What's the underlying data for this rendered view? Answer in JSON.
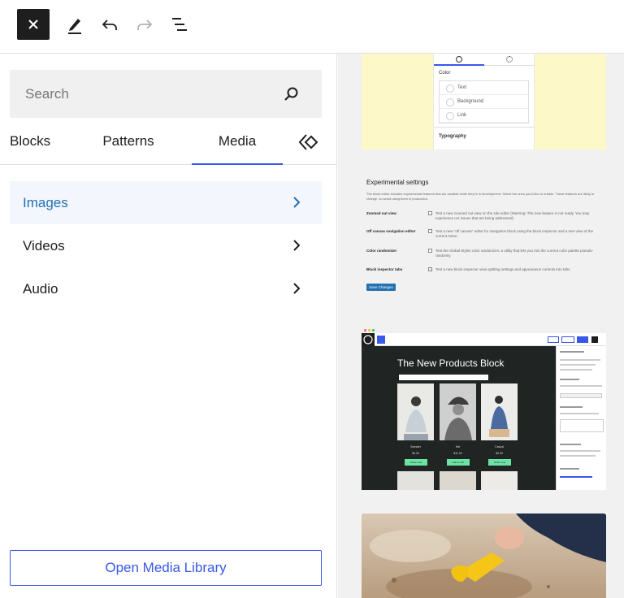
{
  "toolbar": {
    "close_label": "Close block inserter",
    "tools_label": "Tools",
    "undo_label": "Undo",
    "redo_label": "Redo",
    "list_view_label": "Document overview"
  },
  "inserter": {
    "search": {
      "placeholder": "Search",
      "value": ""
    },
    "tabs": [
      {
        "label": "Blocks",
        "active": false
      },
      {
        "label": "Patterns",
        "active": false
      },
      {
        "label": "Media",
        "active": true
      }
    ],
    "media_categories": [
      {
        "label": "Images",
        "active": true
      },
      {
        "label": "Videos",
        "active": false
      },
      {
        "label": "Audio",
        "active": false
      }
    ],
    "open_library_label": "Open Media Library"
  },
  "preview": {
    "color_card": {
      "section_label": "Color",
      "rows": [
        "Text",
        "Background",
        "Link"
      ],
      "typography_label": "Typography"
    },
    "experimental_card": {
      "title": "Experimental settings",
      "description": "The block editor includes experimental features that are useable while they're in development. Select the ones you'd like to enable. These features are likely to change, so avoid using them in production.",
      "settings": [
        {
          "label": "Zoomed out view",
          "text": "Test a new zoomed out view on the site editor (Warning: The new feature is not ready. You may experience UX issues that are being addressed)"
        },
        {
          "label": "Off canvas navigation editor",
          "text": "Test a new \"off canvas\" editor for navigation block using the block inspector and a tree view of the current menu"
        },
        {
          "label": "Color randomizer",
          "text": "Test the Global Styles color randomizer, a utility that lets you mix the current color palette pseudo-randomly."
        },
        {
          "label": "Block inspector tabs",
          "text": "Test a new block inspector view splitting settings and appearance controls into tabs"
        }
      ],
      "save_label": "Save Changes"
    },
    "products_card": {
      "heading": "The New Products Block",
      "products": [
        {
          "name": "Sweater",
          "price": "$4.00",
          "button": "Order now"
        },
        {
          "name": "Hat",
          "price": "$11.00",
          "button": "Add to cart"
        },
        {
          "name": "Casual",
          "price": "$4.00",
          "button": "Order now"
        }
      ]
    }
  },
  "colors": {
    "accent": "#3858e9",
    "active_text": "#2271b1",
    "active_bg": "#f3f6fc",
    "preview_bg": "#f1f1f1"
  }
}
